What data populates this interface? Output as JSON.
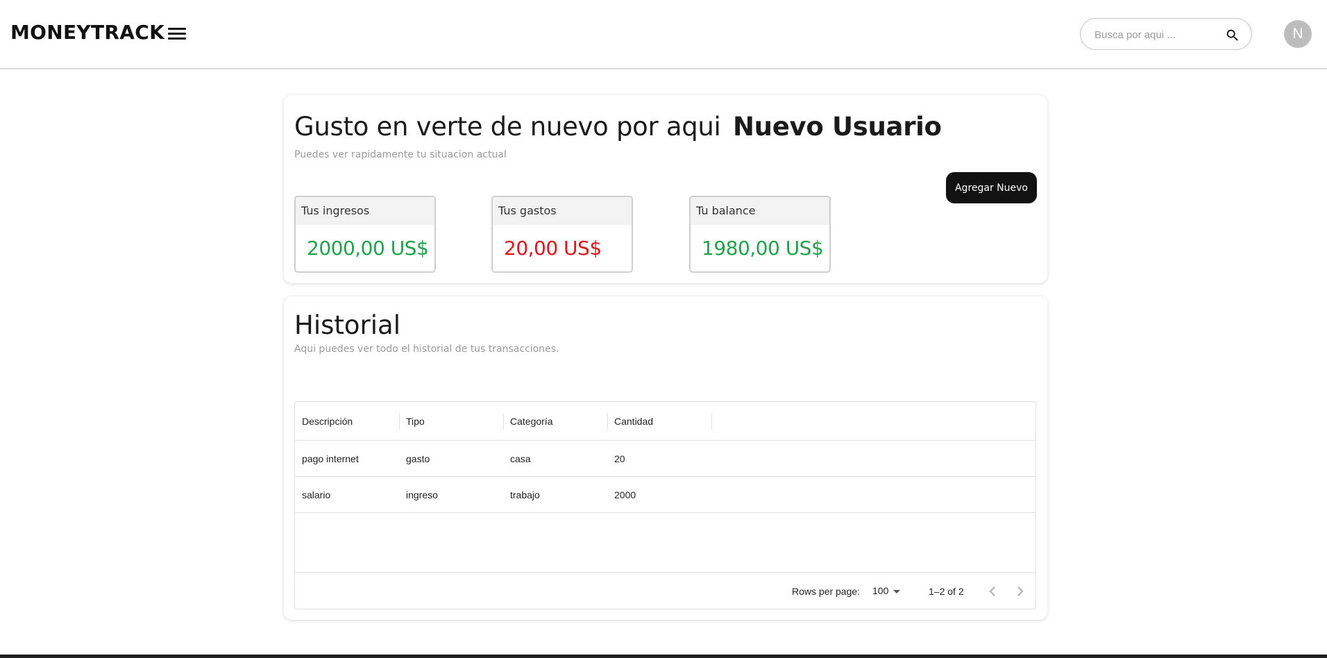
{
  "header": {
    "brand": "MONEYTRACK",
    "search_placeholder": "Busca por aqui ...",
    "avatar_initial": "N"
  },
  "welcome": {
    "greeting": "Gusto en verte de nuevo por aqui",
    "username": "Nuevo Usuario",
    "subtitle": "Puedes ver rapidamente tu situacion actual",
    "add_button": "Agregar Nuevo",
    "stats": [
      {
        "label": "Tus ingresos",
        "value": "2000,00 US$",
        "color": "#1ea34a"
      },
      {
        "label": "Tus gastos",
        "value": "20,00 US$",
        "color": "#e0141e"
      },
      {
        "label": "Tu balance",
        "value": "1980,00 US$",
        "color": "#1ea34a"
      }
    ]
  },
  "history": {
    "title": "Historial",
    "subtitle": "Aqui puedes ver todo el historial de tus transacciones.",
    "columns": [
      "Descripción",
      "Tipo",
      "Categoría",
      "Cantidad"
    ],
    "rows": [
      [
        "pago internet",
        "gasto",
        "casa",
        "20"
      ],
      [
        "salario",
        "ingreso",
        "trabajo",
        "2000"
      ]
    ],
    "footer": {
      "rows_per_page_label": "Rows per page:",
      "rows_per_page_value": "100",
      "page_info": "1–2 of 2"
    }
  },
  "icons": {
    "menu": "menu-icon",
    "search": "search-icon",
    "prev": "chevron-left-icon",
    "next": "chevron-right-icon",
    "dropdown": "caret-down-icon"
  }
}
